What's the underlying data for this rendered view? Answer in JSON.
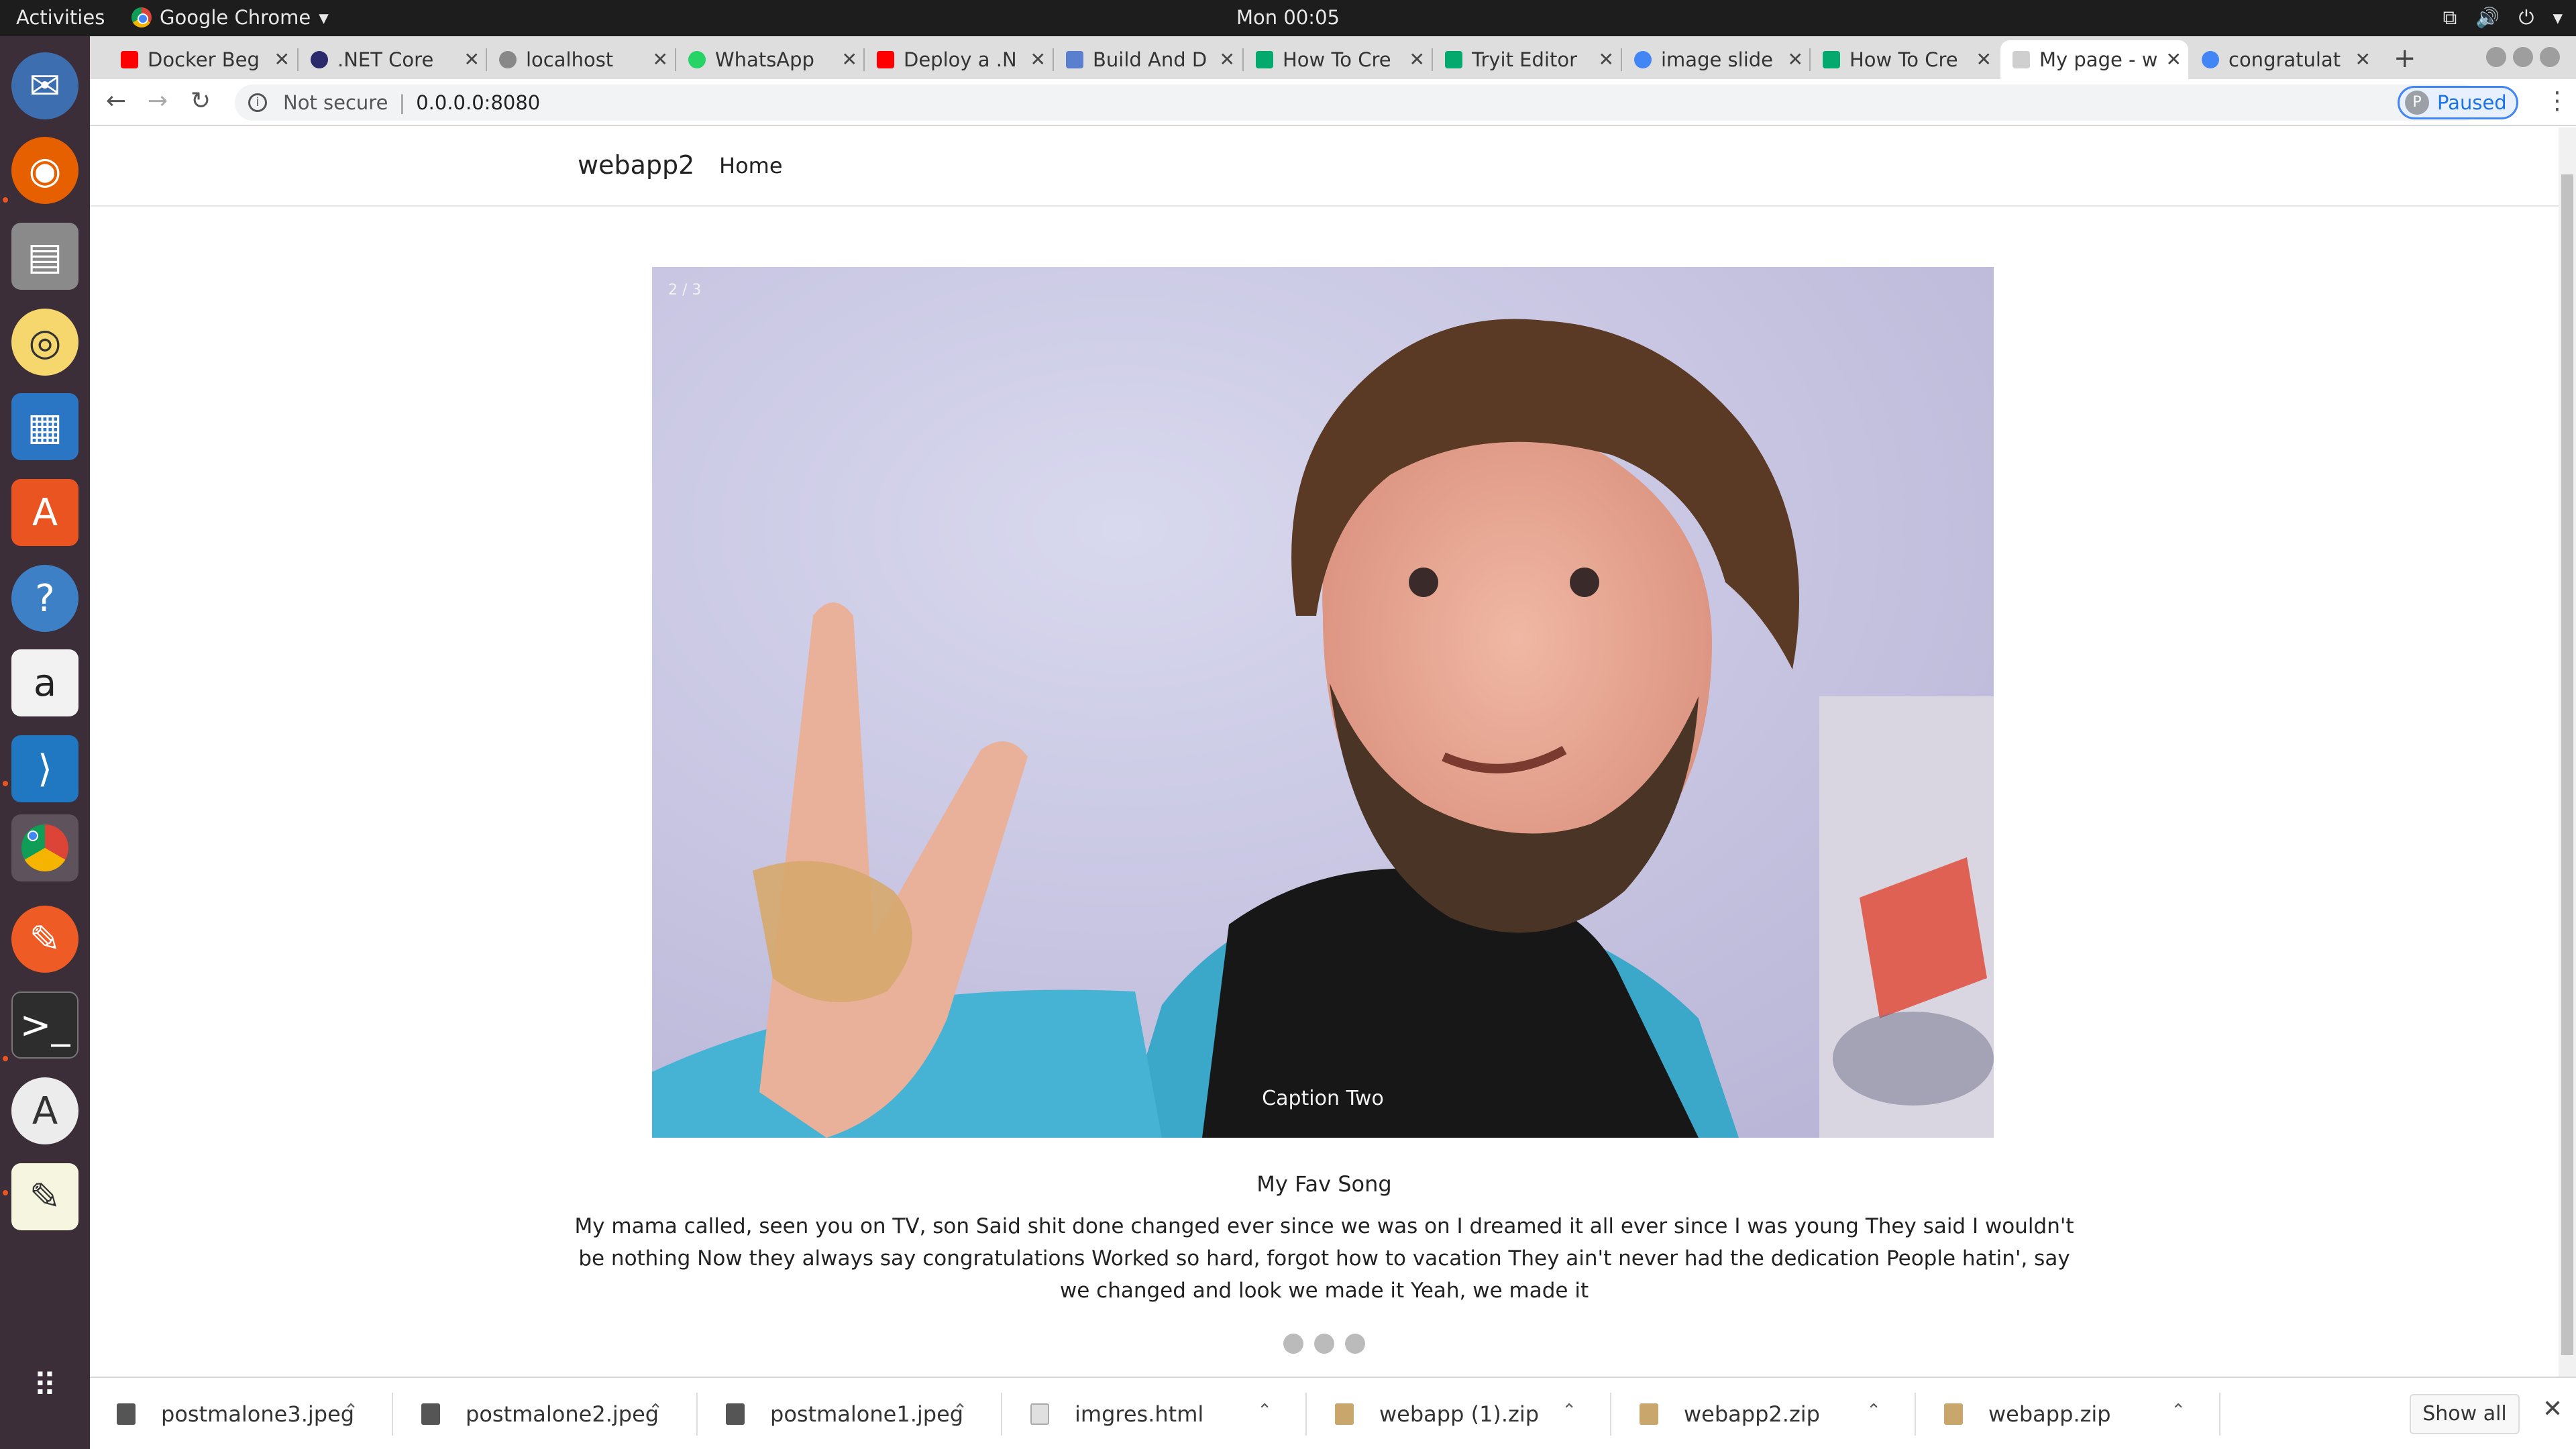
{
  "topbar": {
    "activities": "Activities",
    "app_name": "Google Chrome",
    "clock": "Mon 00:05"
  },
  "dock": {
    "items": [
      "thunderbird-icon",
      "firefox-icon",
      "files-icon",
      "rhythmbox-icon",
      "libreoffice-impress-icon",
      "software-center-icon",
      "help-icon",
      "amazon-icon",
      "vscode-icon",
      "chrome-icon",
      "postman-icon",
      "terminal-icon",
      "software-updater-icon",
      "text-editor-icon",
      "show-apps-icon"
    ]
  },
  "tabs": [
    {
      "label": "Docker Beg",
      "favicon": "youtube",
      "color": "#ff0000"
    },
    {
      "label": ".NET Core",
      "favicon": "dotnet",
      "color": "#2b2b6b"
    },
    {
      "label": "localhost",
      "favicon": "globe",
      "color": "#888888"
    },
    {
      "label": "WhatsApp",
      "favicon": "whatsapp",
      "color": "#25d366"
    },
    {
      "label": "Deploy a .N",
      "favicon": "youtube",
      "color": "#ff0000"
    },
    {
      "label": "Build And D",
      "favicon": "doc",
      "color": "#5b7fcf"
    },
    {
      "label": "How To Cre",
      "favicon": "w3schools",
      "color": "#04aa6d"
    },
    {
      "label": "Tryit Editor",
      "favicon": "w3schools",
      "color": "#04aa6d"
    },
    {
      "label": "image slide",
      "favicon": "google",
      "color": "#4285f4"
    },
    {
      "label": "How To Cre",
      "favicon": "w3schools",
      "color": "#04aa6d"
    },
    {
      "label": "My page - w",
      "favicon": "page",
      "color": "#cfcfcf"
    },
    {
      "label": "congratulat",
      "favicon": "google",
      "color": "#4285f4"
    }
  ],
  "active_tab_index": 10,
  "toolbar": {
    "not_secure": "Not secure",
    "url": "0.0.0.0:8080",
    "profile_initial": "P",
    "profile_status": "Paused"
  },
  "page": {
    "brand": "webapp2",
    "nav_home": "Home",
    "slide_number": "2 / 3",
    "caption": "Caption Two",
    "song_title": "My Fav Song",
    "lyrics": "My mama called, seen you on TV, son Said shit done changed ever since we was on I dreamed it all ever since I was young They said I wouldn't be nothing Now they always say congratulations Worked so hard, forgot how to vacation They ain't never had the dedication People hatin', say we changed and look we made it Yeah, we made it",
    "dots": 3
  },
  "downloads": [
    {
      "name": "postmalone3.jpeg",
      "type": "image"
    },
    {
      "name": "postmalone2.jpeg",
      "type": "image"
    },
    {
      "name": "postmalone1.jpeg",
      "type": "image"
    },
    {
      "name": "imgres.html",
      "type": "html"
    },
    {
      "name": "webapp (1).zip",
      "type": "zip"
    },
    {
      "name": "webapp2.zip",
      "type": "zip"
    },
    {
      "name": "webapp.zip",
      "type": "zip"
    }
  ],
  "show_all": "Show all"
}
